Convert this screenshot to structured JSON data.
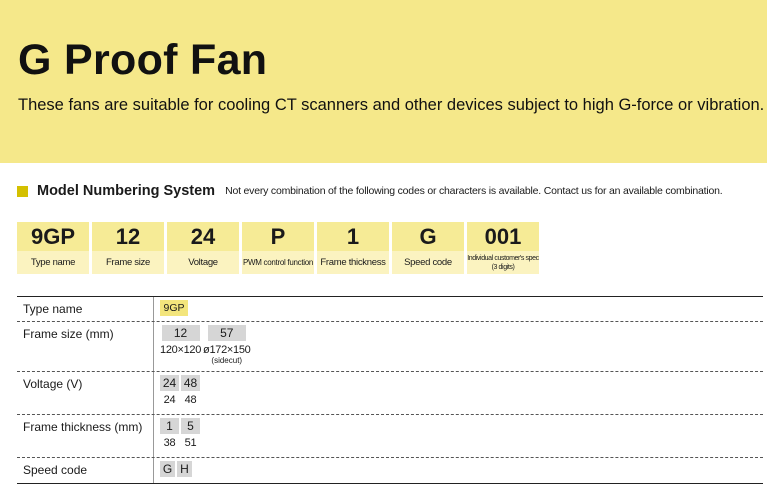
{
  "banner": {
    "title": "G Proof Fan",
    "subtitle": "These fans are suitable for cooling CT scanners and other devices subject to high G-force or vibration."
  },
  "section": {
    "label": "Model Numbering System",
    "note": "Not every combination of the following codes or characters is available. Contact us for an available combination."
  },
  "codes": [
    {
      "code": "9GP",
      "desc": "Type name"
    },
    {
      "code": "12",
      "desc": "Frame size"
    },
    {
      "code": "24",
      "desc": "Voltage"
    },
    {
      "code": "P",
      "desc": "PWM control function"
    },
    {
      "code": "1",
      "desc": "Frame thickness"
    },
    {
      "code": "G",
      "desc": "Speed code"
    },
    {
      "code": "001",
      "desc": "Individual customer's spec (3 digits)"
    }
  ],
  "spec": {
    "type_name": {
      "label": "Type name",
      "value": "9GP"
    },
    "frame_size": {
      "label": "Frame size (mm)",
      "values": [
        {
          "code": "12",
          "size": "120×120"
        },
        {
          "code": "57",
          "size": "ø172×150",
          "note": "(sidecut)"
        }
      ]
    },
    "voltage": {
      "label": "Voltage (V)",
      "values": [
        {
          "code": "24",
          "size": "24"
        },
        {
          "code": "48",
          "size": "48"
        }
      ]
    },
    "frame_thickness": {
      "label": "Frame thickness (mm)",
      "values": [
        {
          "code": "1",
          "size": "38"
        },
        {
          "code": "5",
          "size": "51"
        }
      ]
    },
    "speed_code": {
      "label": "Speed code",
      "values": [
        "G",
        "H"
      ]
    }
  },
  "colors": {
    "banner": "#f5e88a",
    "marker": "#d4c000",
    "chip": "#d6d6d6",
    "chip_highlight": "#f3e57c"
  }
}
